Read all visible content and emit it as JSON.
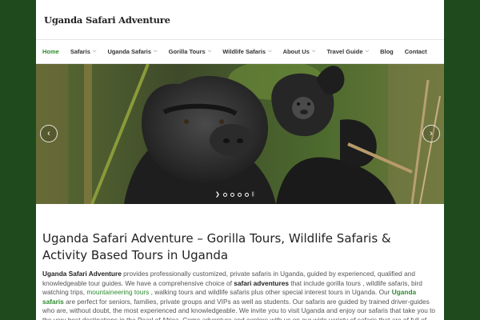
{
  "site": {
    "logo": "Uganda Safari Adventure"
  },
  "nav": {
    "items": [
      {
        "label": "Home",
        "active": true,
        "dropdown": false
      },
      {
        "label": "Safaris",
        "active": false,
        "dropdown": true
      },
      {
        "label": "Uganda Safaris",
        "active": false,
        "dropdown": true
      },
      {
        "label": "Gorilla Tours",
        "active": false,
        "dropdown": true
      },
      {
        "label": "Wildlife Safaris",
        "active": false,
        "dropdown": true
      },
      {
        "label": "About Us",
        "active": false,
        "dropdown": true
      },
      {
        "label": "Travel Guide",
        "active": false,
        "dropdown": true
      },
      {
        "label": "Blog",
        "active": false,
        "dropdown": false
      },
      {
        "label": "Contact",
        "active": false,
        "dropdown": false
      }
    ]
  },
  "slider": {
    "prev_icon": "chevron-left-icon",
    "next_icon": "chevron-right-icon",
    "dot_count": 4,
    "active_dot": 1
  },
  "main": {
    "title": "Uganda Safari Adventure – Gorilla Tours, Wildlife Safaris & Activity Based Tours in Uganda",
    "intro": {
      "s1": "Uganda Safari Adventure",
      "s2": " provides professionally customized, private safaris in Uganda, guided by experienced,  qualified and knowledgeable tour guides. We have a comprehensive choice of ",
      "s3": "safari adventures",
      "s4": " that include gorilla tours , wildlife safaris, bird watching trips, ",
      "s5": "mountaineering tours",
      "s6": " , walking tours and wildlife safaris plus other special interest tours in Uganda.  Our ",
      "s7": "Uganda safaris",
      "s8": " are perfect for seniors, families, private groups and VIPs as well as students. Our safaris are guided by trained driver-guides who are, without doubt, the most experienced and knowledgeable. We invite you to visit Uganda and enjoy our safaris that take you to the very best destinations in the Pearl of Africa.  Come adventure and explore with us on our wide variety of safaris that are of full of"
    }
  },
  "colors": {
    "accent": "#2e8b2e",
    "frame": "#1e4a1e"
  }
}
